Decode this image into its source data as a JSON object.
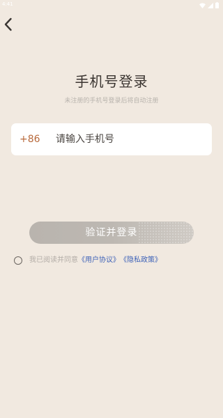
{
  "status_bar": {
    "time": "4:41",
    "icons": [
      "wifi-icon",
      "signal-icon",
      "battery-icon"
    ]
  },
  "nav": {
    "back_icon": "back-arrow-icon"
  },
  "login": {
    "title": "手机号登录",
    "subtitle": "未注册的手机号登录后将自动注册",
    "country_code": "+86",
    "phone_placeholder": "请输入手机号",
    "phone_value": "",
    "verify_button_label": "验证并登录"
  },
  "agreement": {
    "prefix": "我已阅读并同意",
    "user_agreement": "《用户协议》",
    "privacy_policy": "《隐私政策》",
    "checked": false
  },
  "colors": {
    "background": "#f1e9e0",
    "country_code": "#b86a3c",
    "link": "#3f63b8",
    "button": "#bdb8b2"
  }
}
